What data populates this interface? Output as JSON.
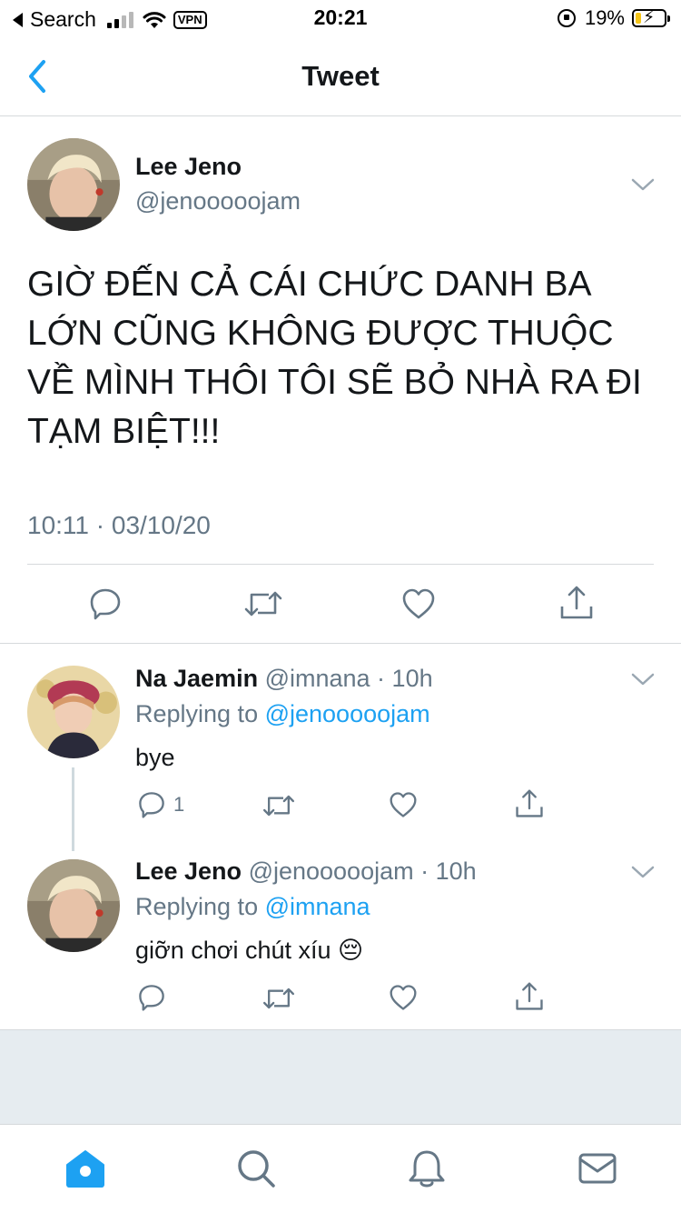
{
  "status_bar": {
    "back_label": "Search",
    "vpn": "VPN",
    "time": "20:21",
    "battery_percent": "19%",
    "battery_level": 0.19
  },
  "header": {
    "title": "Tweet"
  },
  "main_tweet": {
    "name": "Lee Jeno",
    "handle": "@jenooooojam",
    "text": "GIỜ ĐẾN CẢ CÁI CHỨC DANH BA LỚN CŨNG KHÔNG ĐƯỢC THUỘC VỀ MÌNH THÔI TÔI SẼ BỎ NHÀ RA ĐI TẠM BIỆT!!!",
    "timestamp": "10:11 · 03/10/20"
  },
  "replies": [
    {
      "name": "Na Jaemin",
      "meta": "@imnana · 10h",
      "replying_prefix": "Replying to ",
      "replying_to": "@jenooooojam",
      "text": "bye",
      "reply_count": "1"
    },
    {
      "name": "Lee Jeno",
      "meta": "@jenooooojam · 10h",
      "replying_prefix": "Replying to ",
      "replying_to": "@imnana",
      "text": "giỡn chơi chút xíu 😔",
      "reply_count": ""
    }
  ],
  "icons": {
    "reply": "reply-icon",
    "retweet": "retweet-icon",
    "like": "heart-icon",
    "share": "share-icon",
    "tabs": [
      "home-icon",
      "search-icon",
      "bell-icon",
      "mail-icon"
    ]
  },
  "colors": {
    "accent": "#1da1f2",
    "secondary_text": "#657786",
    "divider": "#d6d9dc",
    "background_gray": "#e6ecf0"
  }
}
